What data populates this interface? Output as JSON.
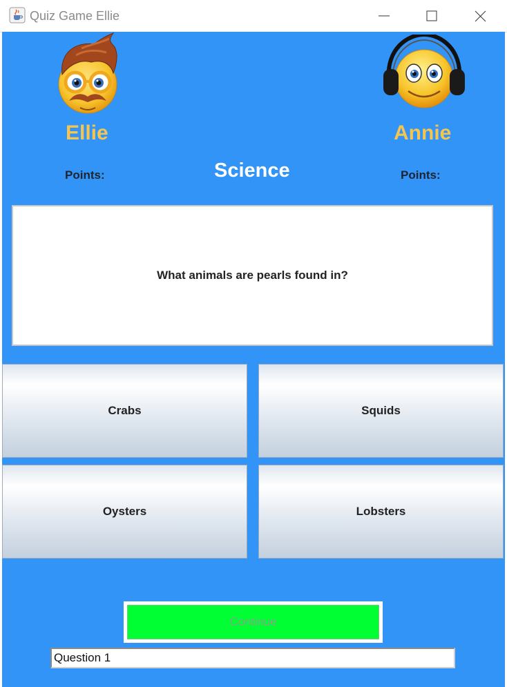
{
  "window": {
    "title": "Quiz Game Ellie",
    "app_icon": "java-coffee-cup-icon",
    "controls": [
      "minimize-icon",
      "maximize-icon",
      "close-icon"
    ]
  },
  "players": [
    {
      "name": "Ellie",
      "points_label": "Points:",
      "avatar": "nerd-emoji-with-glasses-icon"
    },
    {
      "name": "Annie",
      "points_label": "Points:",
      "avatar": "smiley-with-headphones-icon"
    }
  ],
  "category": "Science",
  "question": "What animals are pearls found in?",
  "answers": [
    "Crabs",
    "Squids",
    "Oysters",
    "Lobsters"
  ],
  "continue_label": "Continue",
  "status": "Question 1",
  "colors": {
    "background": "#3394f7",
    "player_name": "#f5c54f",
    "continue_button": "#00ff33"
  }
}
